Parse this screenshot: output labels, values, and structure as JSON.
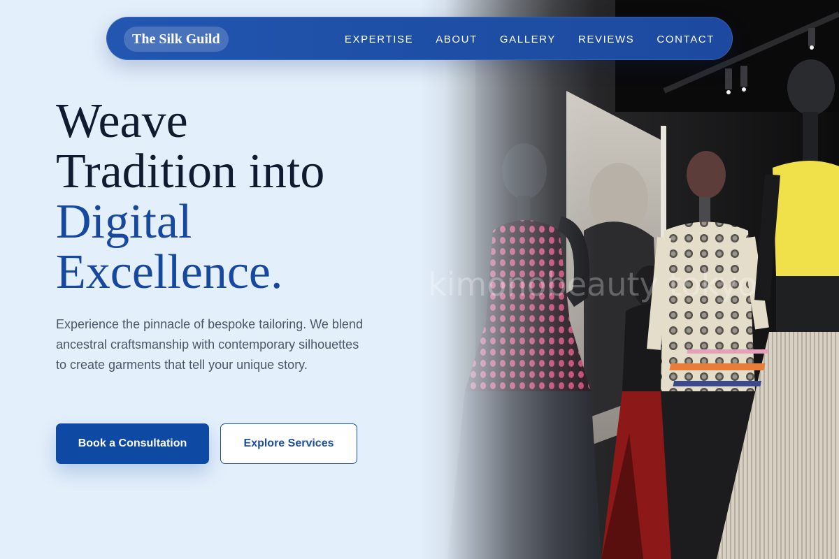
{
  "nav": {
    "brand": "The Silk Guild",
    "links": [
      "EXPERTISE",
      "ABOUT",
      "GALLERY",
      "REVIEWS",
      "CONTACT"
    ]
  },
  "hero": {
    "headline_line1": "Weave",
    "headline_line2": "Tradition into",
    "headline_accent1": "Digital",
    "headline_accent2": "Excellence.",
    "lead": "Experience the pinnacle of bespoke tailoring. We blend ancestral craftsmanship with contemporary silhouettes to create garments that tell your unique story.",
    "primary_button": "Book a Consultation",
    "secondary_button": "Explore Services",
    "image_watermark": "kimonobeauty tokyo"
  },
  "colors": {
    "background": "#e3effb",
    "nav": "#1e4fa6",
    "accent": "#1648a0",
    "primary_button": "#0e4aa3",
    "headline": "#0f1b2e"
  }
}
